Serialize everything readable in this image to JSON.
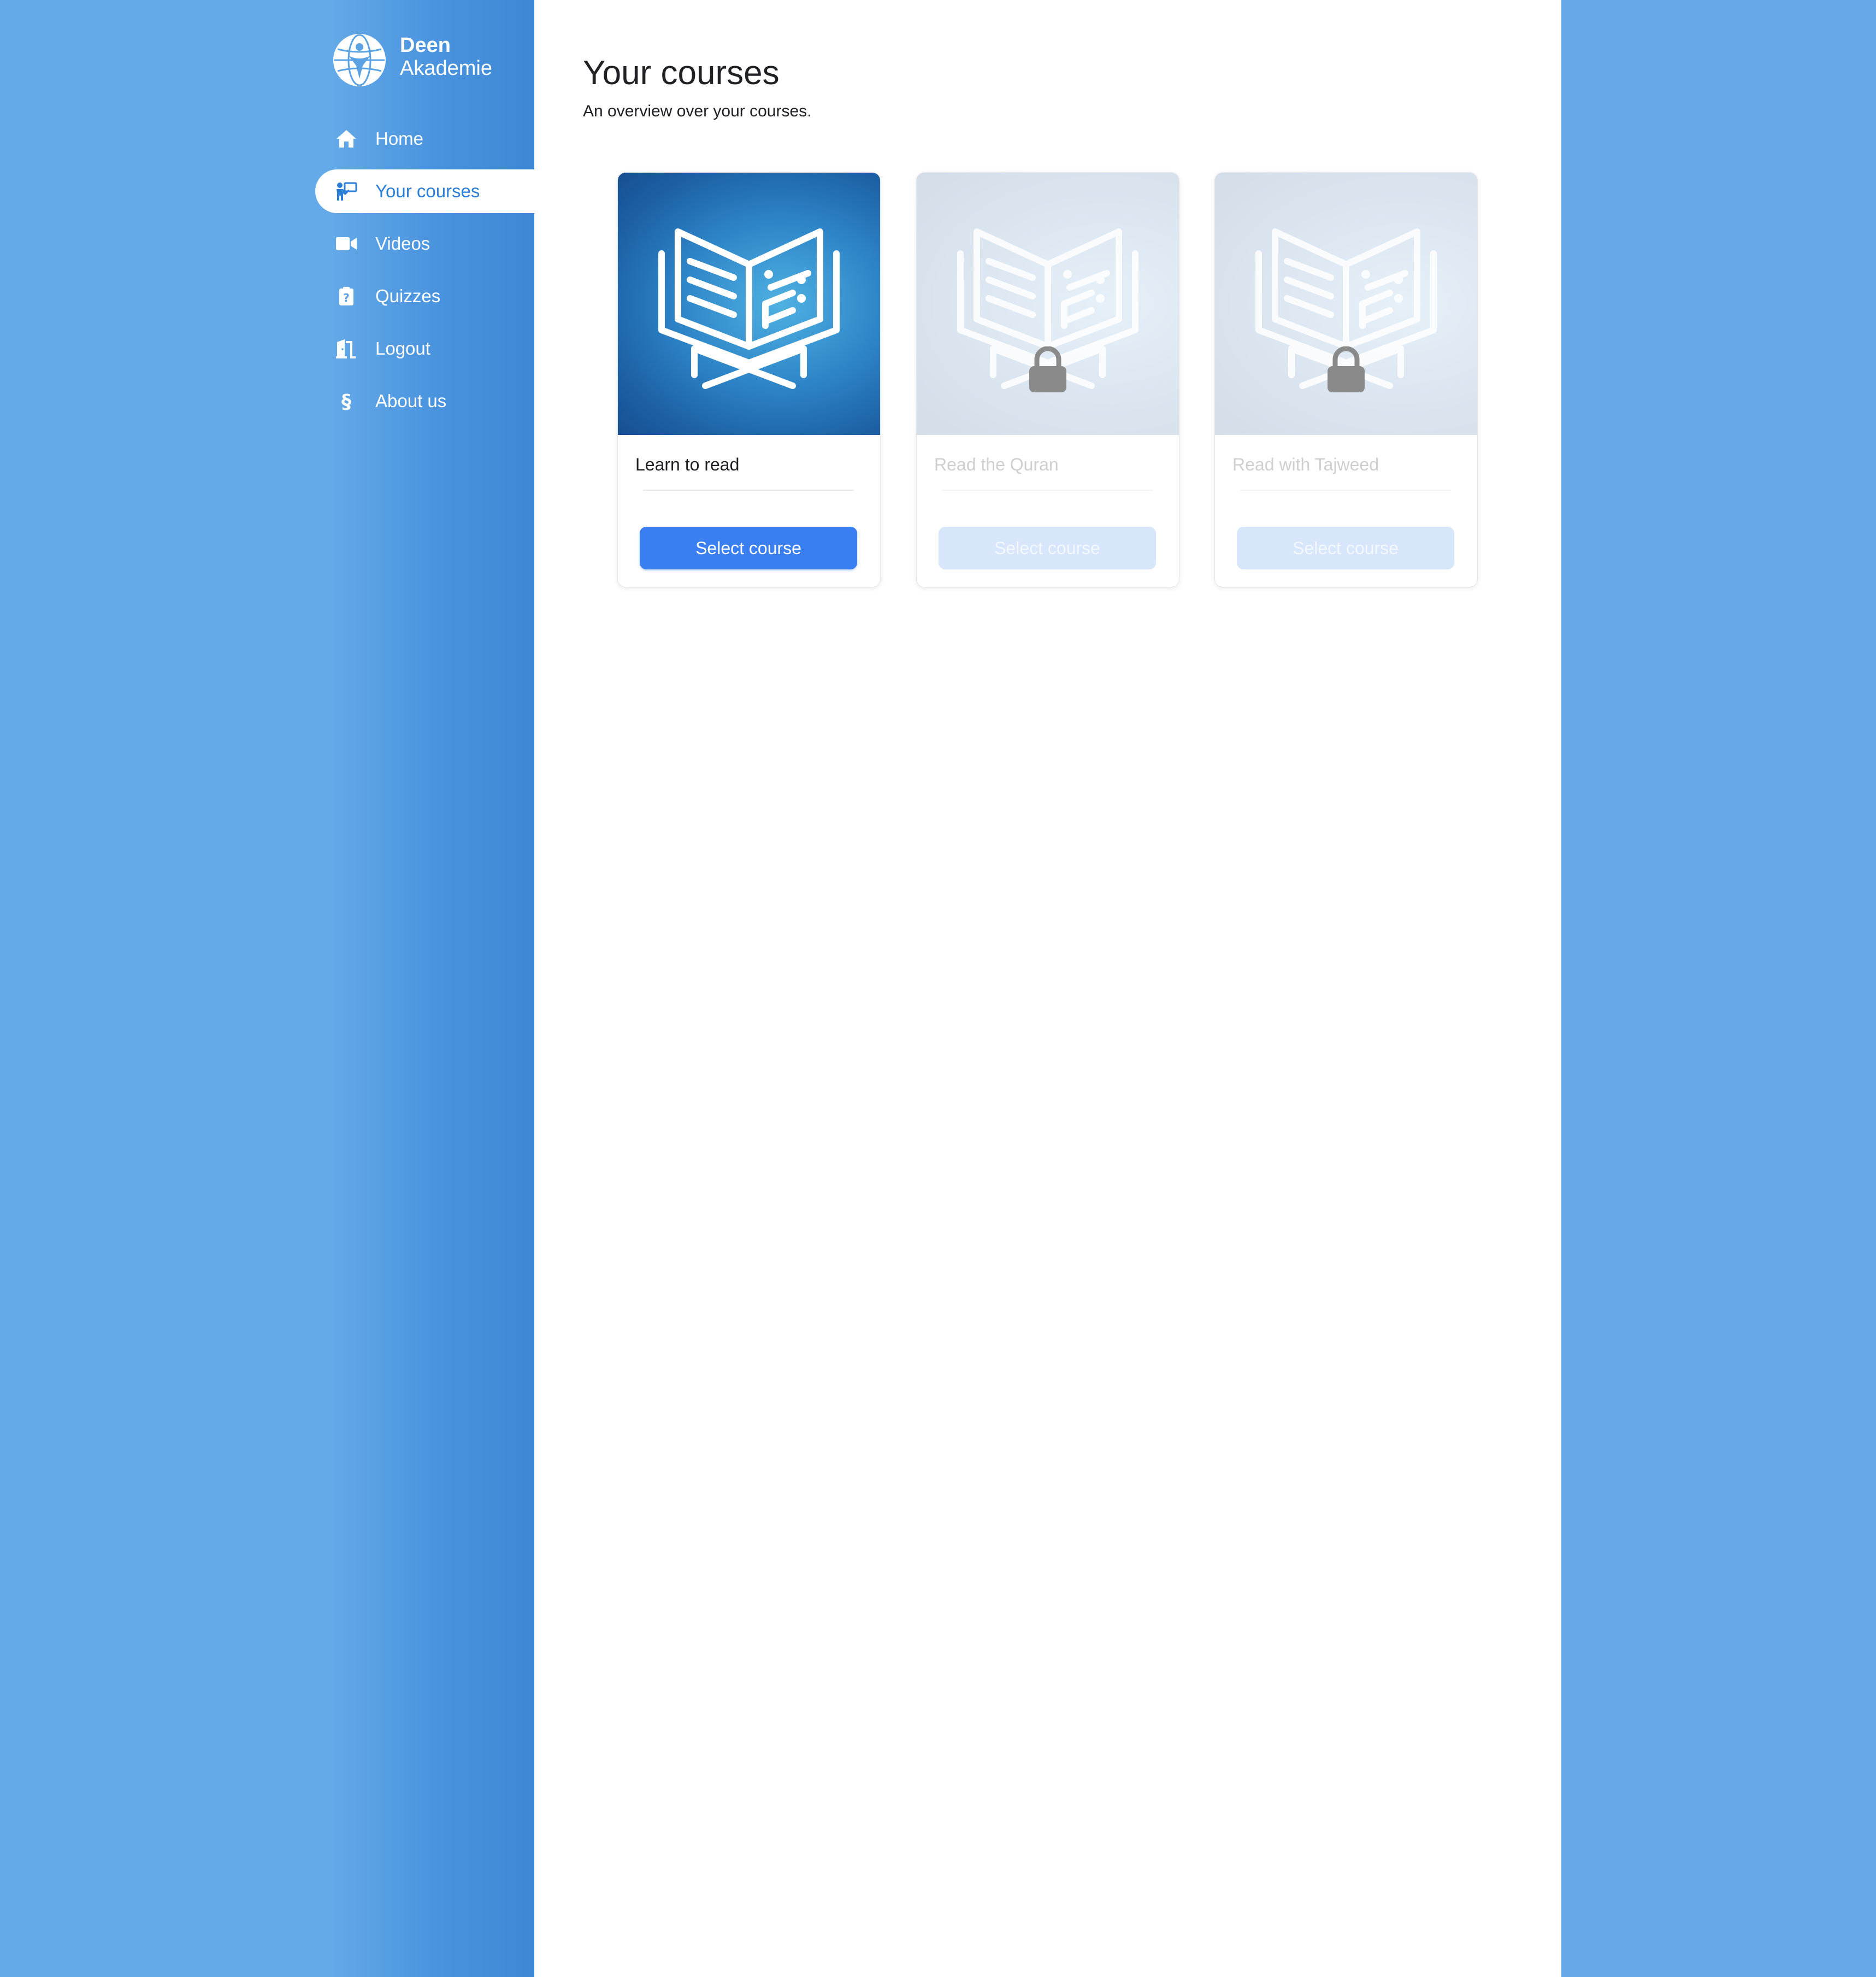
{
  "app": {
    "logo_line1": "Deen",
    "logo_line2": "Akademie"
  },
  "sidebar": {
    "items": [
      {
        "label": "Home",
        "icon": "home-icon",
        "active": false
      },
      {
        "label": "Your courses",
        "icon": "teacher-icon",
        "active": true
      },
      {
        "label": "Videos",
        "icon": "video-camera-icon",
        "active": false
      },
      {
        "label": "Quizzes",
        "icon": "quiz-clipboard-icon",
        "active": false
      },
      {
        "label": "Logout",
        "icon": "door-open-icon",
        "active": false
      },
      {
        "label": "About us",
        "icon": "section-sign-icon",
        "active": false
      }
    ]
  },
  "main": {
    "title": "Your courses",
    "subtitle": "An overview over your courses.",
    "courses": [
      {
        "title": "Learn to read",
        "button_label": "Select course",
        "locked": false,
        "icon": "open-book-icon"
      },
      {
        "title": "Read the Quran",
        "button_label": "Select course",
        "locked": true,
        "icon": "open-book-icon"
      },
      {
        "title": "Read with Tajweed",
        "button_label": "Select course",
        "locked": true,
        "icon": "open-book-icon"
      }
    ]
  },
  "colors": {
    "background": "#65a9e6",
    "sidebar_dark": "#3d87d4",
    "active_text": "#2b7fd6",
    "button": "#3a7ff1",
    "button_disabled": "#d8e6fc",
    "lock": "#8a8a8a"
  }
}
